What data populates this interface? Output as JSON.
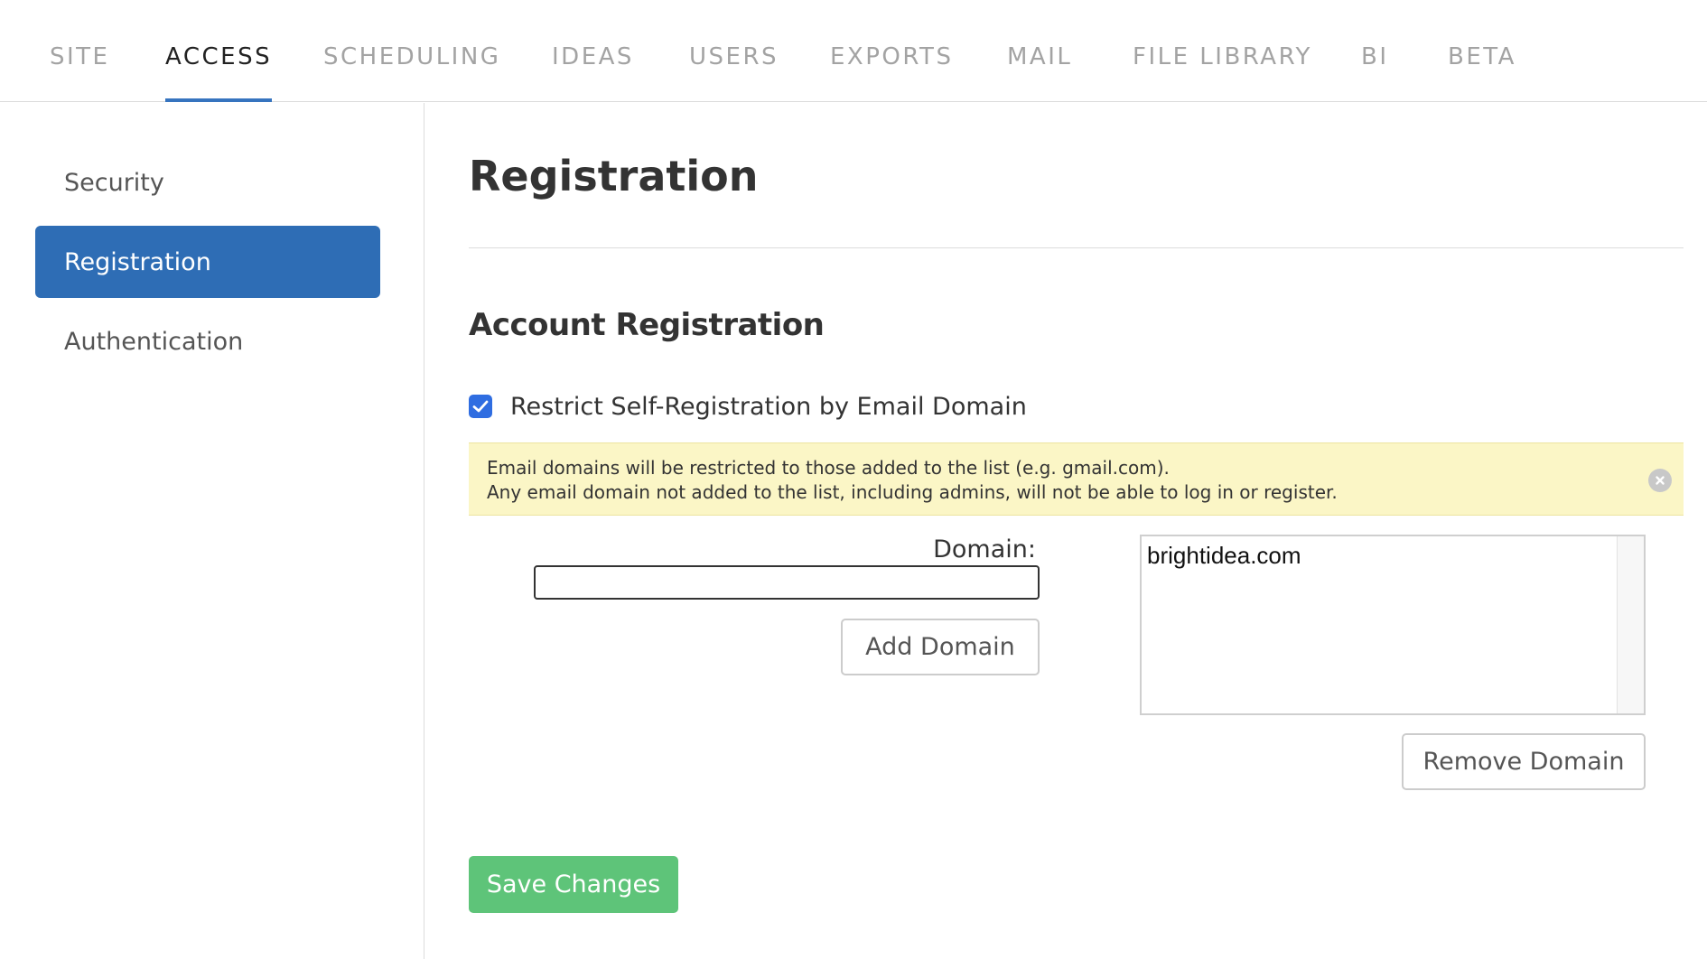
{
  "top_nav": {
    "tabs": [
      {
        "label": "SITE"
      },
      {
        "label": "ACCESS"
      },
      {
        "label": "SCHEDULING"
      },
      {
        "label": "IDEAS"
      },
      {
        "label": "USERS"
      },
      {
        "label": "EXPORTS"
      },
      {
        "label": "MAIL"
      },
      {
        "label": "FILE LIBRARY"
      },
      {
        "label": "BI"
      },
      {
        "label": "BETA"
      }
    ],
    "active_tab": "ACCESS"
  },
  "sidebar": {
    "items": [
      {
        "label": "Security"
      },
      {
        "label": "Registration"
      },
      {
        "label": "Authentication"
      }
    ],
    "active_item": "Registration"
  },
  "main": {
    "title": "Registration",
    "section_title": "Account Registration",
    "restrict_checkbox": {
      "label": "Restrict Self-Registration by Email Domain",
      "checked": true
    },
    "notice": {
      "line1": "Email domains will be restricted to those added to the list (e.g. gmail.com).",
      "line2": "Any email domain not added to the list, including admins, will not be able to log in or register."
    },
    "domain_label": "Domain:",
    "domain_input_value": "",
    "add_domain_label": "Add Domain",
    "domains": [
      "brightidea.com"
    ],
    "remove_domain_label": "Remove Domain",
    "save_label": "Save Changes"
  },
  "colors": {
    "accent_blue": "#3674bf",
    "sidebar_active_bg": "#2e6db5",
    "checkbox_blue": "#2f6de1",
    "notice_bg": "#fbf6c6",
    "save_green": "#5ec479"
  },
  "icons": {
    "checkbox": "checkmark-icon",
    "notice_close": "close-circle-icon"
  }
}
